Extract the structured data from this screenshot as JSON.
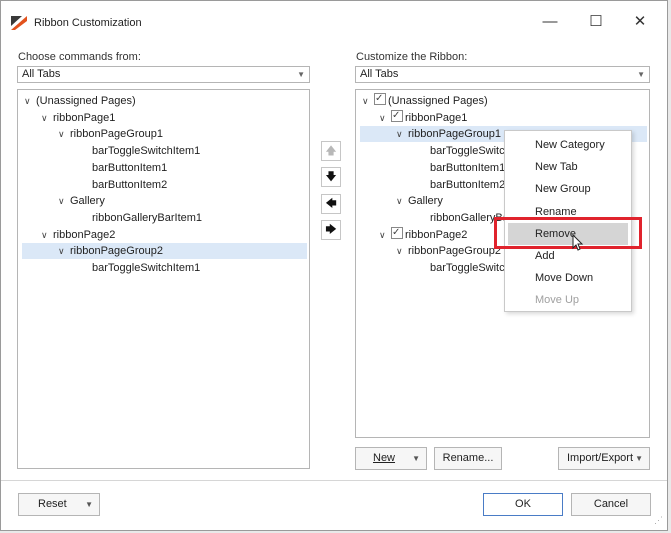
{
  "window": {
    "title": "Ribbon Customization",
    "minimize": "—",
    "maximize": "☐",
    "close": "✕"
  },
  "left": {
    "label": "Choose commands from:",
    "combo_value": "All Tabs",
    "tree": [
      {
        "text": "(Unassigned Pages)",
        "chevron": "∨"
      },
      {
        "text": "ribbonPage1",
        "chevron": "∨"
      },
      {
        "text": "ribbonPageGroup1",
        "chevron": "∨"
      },
      {
        "text": "barToggleSwitchItem1"
      },
      {
        "text": "barButtonItem1"
      },
      {
        "text": "barButtonItem2"
      },
      {
        "text": "Gallery",
        "chevron": "∨"
      },
      {
        "text": "ribbonGalleryBarItem1"
      },
      {
        "text": "ribbonPage2",
        "chevron": "∨"
      },
      {
        "text": "ribbonPageGroup2",
        "chevron": "∨",
        "selected": true
      },
      {
        "text": "barToggleSwitchItem1"
      }
    ]
  },
  "middle": {
    "buttons": [
      {
        "glyph": "🡅",
        "name": "move-up-arrow-button",
        "disabled": true
      },
      {
        "glyph": "🡇",
        "name": "move-down-arrow-button",
        "disabled": false
      },
      {
        "glyph": "🡄",
        "name": "remove-arrow-button",
        "disabled": false
      },
      {
        "glyph": "🡆",
        "name": "add-arrow-button",
        "disabled": false
      }
    ]
  },
  "right": {
    "label": "Customize the Ribbon:",
    "combo_value": "All Tabs",
    "tree": [
      {
        "text": "(Unassigned Pages)",
        "chevron": "∨",
        "checked": true
      },
      {
        "text": "ribbonPage1",
        "chevron": "∨",
        "checked": true
      },
      {
        "text": "ribbonPageGroup1",
        "chevron": "∨",
        "selected": true
      },
      {
        "text": "barToggleSwitchI"
      },
      {
        "text": "barButtonItem1"
      },
      {
        "text": "barButtonItem2"
      },
      {
        "text": "Gallery",
        "chevron": "∨"
      },
      {
        "text": "ribbonGalleryBar"
      },
      {
        "text": "ribbonPage2",
        "chevron": "∨",
        "checked": true
      },
      {
        "text": "ribbonPageGroup2",
        "chevron": "∨"
      },
      {
        "text": "barToggleSwitchI"
      }
    ],
    "new_button": "New",
    "rename_button": "Rename...",
    "import_export_button": "Import/Export"
  },
  "context_menu": {
    "items": [
      {
        "label": "New Category",
        "disabled": false
      },
      {
        "label": "New Tab",
        "disabled": false
      },
      {
        "label": "New Group",
        "disabled": false
      },
      {
        "label": "Rename",
        "disabled": false
      },
      {
        "label": "Remove",
        "disabled": false,
        "highlighted": true
      },
      {
        "label": "Add",
        "disabled": false
      },
      {
        "label": "Move Down",
        "disabled": false
      },
      {
        "label": "Move Up",
        "disabled": true
      }
    ]
  },
  "footer": {
    "reset_button": "Reset",
    "ok_button": "OK",
    "cancel_button": "Cancel"
  },
  "colors": {
    "selection": "#dbe8f7",
    "highlight_box": "#e0232d",
    "ok_border": "#4a7cc6"
  }
}
